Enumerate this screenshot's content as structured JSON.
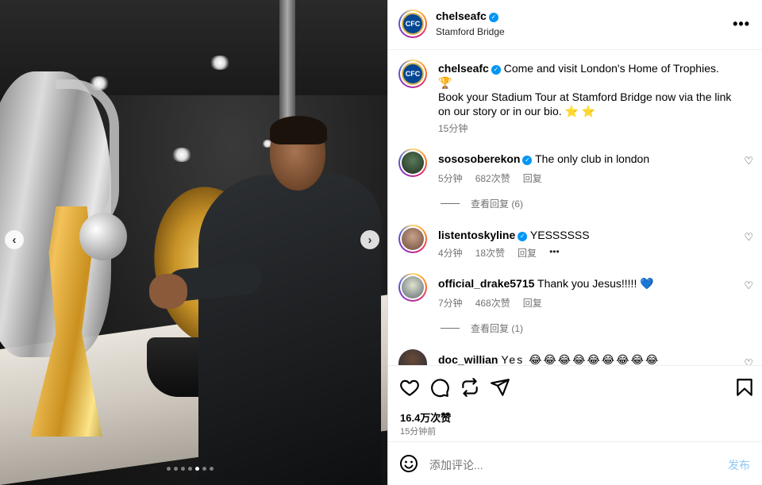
{
  "post": {
    "username": "chelseafc",
    "location": "Stamford Bridge",
    "caption_line1": "Come and visit London's Home of Trophies. 🏆",
    "caption_line2": "Book your Stadium Tour at Stamford Bridge now via the link on our story or in our bio. ⭐ ⭐",
    "caption_time": "15分钟",
    "likes": "16.4万次赞",
    "posted_time": "15分钟前",
    "carousel": {
      "total": 7,
      "active_index": 4
    }
  },
  "comments": [
    {
      "username": "sososoberekon",
      "verified": true,
      "text": "The only club in london",
      "time": "5分钟",
      "likes": "682次赞",
      "reply": "回复",
      "view_replies": "查看回复 (6)"
    },
    {
      "username": "listentoskyline",
      "verified": true,
      "text": "YESSSSSS",
      "time": "4分钟",
      "likes": "18次赞",
      "reply": "回复",
      "more": "•••"
    },
    {
      "username": "official_drake5715",
      "verified": false,
      "text": "Thank you Jesus!!!!! 💙",
      "time": "7分钟",
      "likes": "468次赞",
      "reply": "回复",
      "view_replies": "查看回复 (1)"
    },
    {
      "username": "doc_willian",
      "verified": false,
      "text": "Yes 😂😂😂😂😂😂😂😂😂"
    }
  ],
  "comment_box": {
    "placeholder": "添加评论...",
    "post_label": "发布"
  },
  "icons": {
    "like": "heart-icon",
    "comment": "comment-icon",
    "repost": "repost-icon",
    "share": "share-icon",
    "save": "bookmark-icon",
    "emoji": "emoji-icon",
    "more": "more-icon"
  },
  "colors": {
    "verified": "#0095f6",
    "post_button": "#8fc8f7",
    "chelsea_blue": "#034694"
  }
}
